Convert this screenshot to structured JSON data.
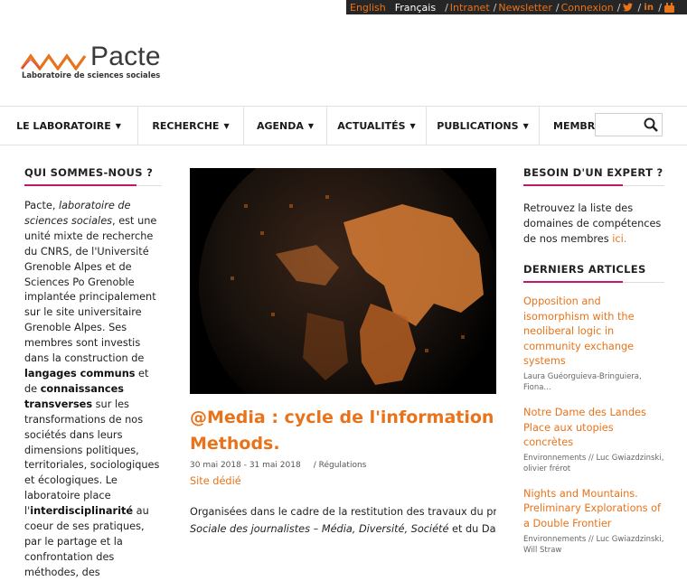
{
  "topbar": {
    "lang_en": "English",
    "lang_fr": "Français",
    "links": [
      {
        "label": "Intranet"
      },
      {
        "label": "Newsletter"
      },
      {
        "label": "Connexion"
      }
    ],
    "social": [
      "twitter-icon",
      "linkedin-icon",
      "youtube-icon"
    ]
  },
  "brand": {
    "name": "Pacte",
    "tagline": "Laboratoire de sciences sociales",
    "color_orange": "#e8731b",
    "color_magenta": "#c2176e"
  },
  "nav": {
    "items": [
      {
        "label": "LE LABORATOIRE"
      },
      {
        "label": "RECHERCHE"
      },
      {
        "label": "AGENDA"
      },
      {
        "label": "ACTUALITÉS"
      },
      {
        "label": "PUBLICATIONS"
      },
      {
        "label": "MEMBRES"
      }
    ],
    "search_placeholder": ""
  },
  "left": {
    "heading": "QUI SOMMES-NOUS ?",
    "p1": "Pacte, ",
    "p1_italic": "laboratoire de sciences sociales",
    "p2": ", est une unité mixte de recherche du CNRS, de l'Université Grenoble Alpes et de Sciences Po Grenoble implantée principalement sur le site universitaire Grenoble Alpes. Ses membres sont investis dans la construction de ",
    "b1": "langages communs",
    "p3": " et de ",
    "b2": "connaissances transverses",
    "p4": " sur les transformations de nos sociétés dans leurs dimensions politiques, territoriales, sociologiques et écologiques. Le laboratoire place l'",
    "b3": "interdisciplinarité",
    "p5": " au coeur de ses pratiques, par le partage et la confrontation des méthodes, des"
  },
  "article": {
    "title_line1": "@Media : cycle de l'information et",
    "title_line2": "Methods.",
    "date": "30 mai 2018 - 31 mai 2018",
    "category": "/ Régulations",
    "site_link": "Site dédié",
    "excerpt_line1": "Organisées dans le cadre de la restitution des travaux du projet A",
    "excerpt_line2_italic": "Sociale des journalistes – Média, Diversité, Société",
    "excerpt_line2_rest": " et du Data Ins"
  },
  "right": {
    "heading1": "BESOIN D'UN EXPERT ?",
    "expert_text": "Retrouvez la liste des domaines de compétences de nos membres ",
    "expert_link": "ici.",
    "heading2": "DERNIERS ARTICLES",
    "articles": [
      {
        "title": "Opposition and isomorphism with the neoliberal logic in community exchange systems",
        "authors": "Laura Guéorguieva-Bringuiera, Fiona..."
      },
      {
        "title": "Notre Dame des Landes Place aux utopies concrètes",
        "authors": "Environnements // Luc Gwiazdzinski, olivier frérot"
      },
      {
        "title": "Nights and Mountains. Preliminary Explorations of a Double Frontier",
        "authors": "Environnements // Luc Gwiazdzinski, Will Straw"
      }
    ]
  }
}
